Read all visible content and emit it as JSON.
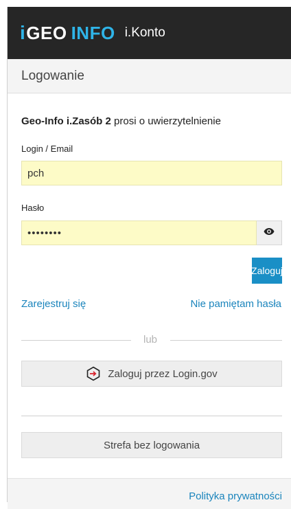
{
  "header": {
    "logo_mark": "i",
    "logo_geo": "GEO",
    "logo_info": "INFO",
    "product": "i.Konto"
  },
  "login": {
    "section_title": "Logowanie",
    "auth_app": "Geo-Info i.Zasób 2",
    "auth_suffix": " prosi o uwierzytelnienie",
    "login_label": "Login / Email",
    "login_value": "pch",
    "password_label": "Hasło",
    "password_value": "••••••••",
    "submit_label": "Zaloguj",
    "register_link": "Zarejestruj się",
    "forgot_link": "Nie pamiętam hasła",
    "or_text": "lub",
    "login_gov_button": "Zaloguj przez Login.gov",
    "no_login_button": "Strefa bez logowania"
  },
  "footer": {
    "privacy_link": "Polityka prywatności"
  },
  "colors": {
    "topbar": "#262626",
    "brand_blue": "#2fb4e8",
    "primary_button": "#1a8fc6",
    "link": "#1a84bc",
    "input_fill": "#fdfbc7"
  },
  "icons": {
    "password_toggle": "eye-icon",
    "login_gov": "login-gov-icon"
  }
}
